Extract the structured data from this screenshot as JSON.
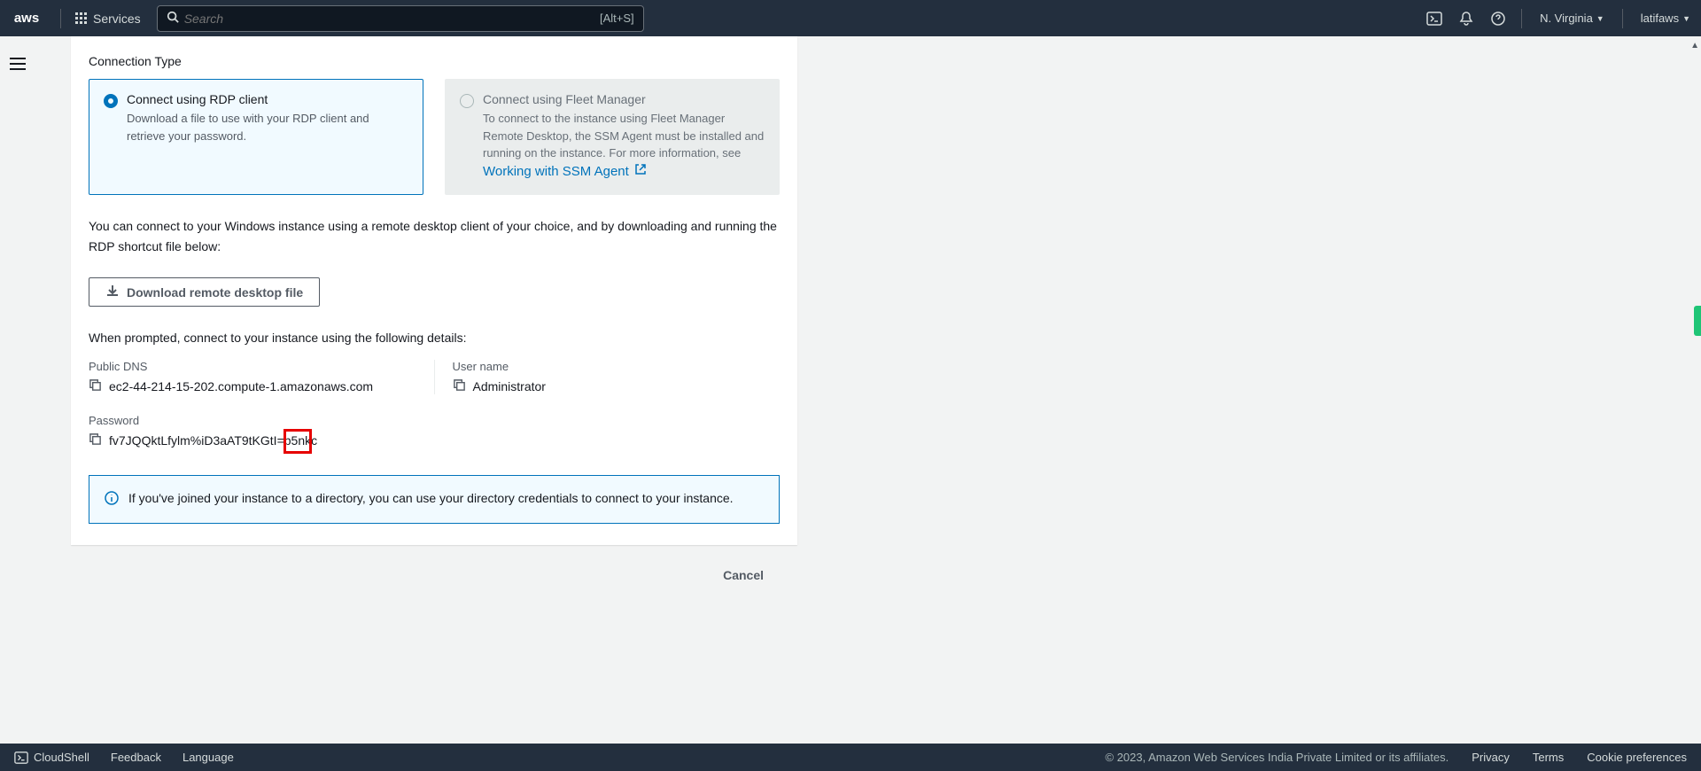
{
  "topnav": {
    "logo": "aws",
    "services_label": "Services",
    "search_placeholder": "Search",
    "search_shortcut": "[Alt+S]",
    "region": "N. Virginia",
    "user": "latifaws"
  },
  "panel": {
    "connection_type_label": "Connection Type",
    "option_rdp": {
      "title": "Connect using RDP client",
      "desc": "Download a file to use with your RDP client and retrieve your password."
    },
    "option_fleet": {
      "title": "Connect using Fleet Manager",
      "desc_pre": "To connect to the instance using Fleet Manager Remote Desktop, the SSM Agent must be installed and running on the instance. For more information, see ",
      "link": "Working with SSM Agent"
    },
    "body_text": "You can connect to your Windows instance using a remote desktop client of your choice, and by downloading and running the RDP shortcut file below:",
    "download_btn": "Download remote desktop file",
    "prompt_text": "When prompted, connect to your instance using the following details:",
    "public_dns_label": "Public DNS",
    "public_dns_value": "ec2-44-214-15-202.compute-1.amazonaws.com",
    "username_label": "User name",
    "username_value": "Administrator",
    "password_label": "Password",
    "password_value": "fv7JQQktLfylm%iD3aAT9tKGtI=p5nkc",
    "info_text": "If you've joined your instance to a directory, you can use your directory credentials to connect to your instance.",
    "cancel": "Cancel"
  },
  "bottombar": {
    "cloudshell": "CloudShell",
    "feedback": "Feedback",
    "language": "Language",
    "copyright": "© 2023, Amazon Web Services India Private Limited or its affiliates.",
    "privacy": "Privacy",
    "terms": "Terms",
    "cookies": "Cookie preferences"
  }
}
